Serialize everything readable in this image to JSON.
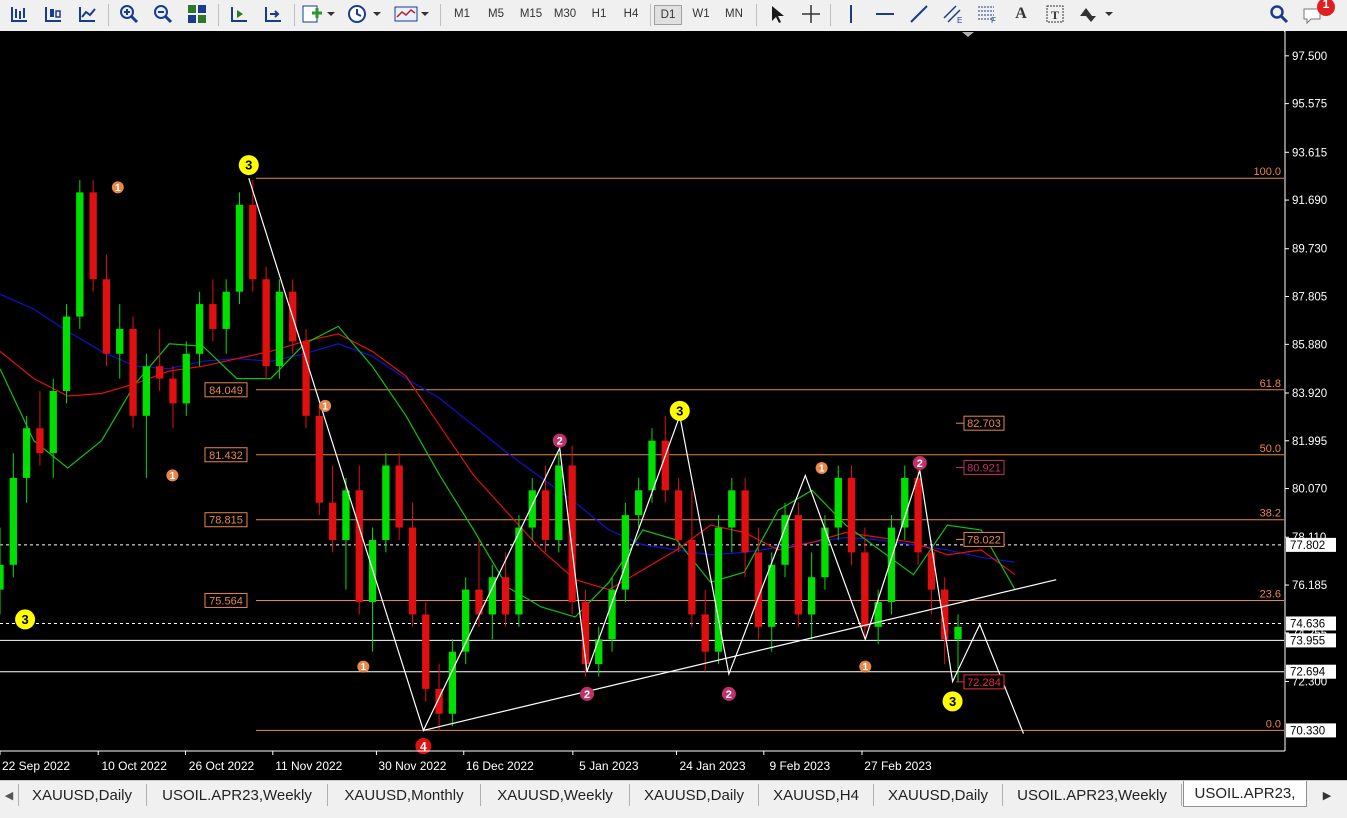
{
  "toolbar": {
    "timeframes": [
      "M1",
      "M5",
      "M15",
      "M30",
      "H1",
      "H4",
      "D1",
      "W1",
      "MN"
    ],
    "notification_count": "1",
    "icons": [
      "bar-chart-icon",
      "candlestick-icon",
      "line-chart-icon",
      "zoom-in-icon",
      "zoom-out-icon",
      "tile-windows-icon",
      "autoscroll-icon",
      "chart-shift-icon",
      "indicators-icon",
      "periods-clock-icon",
      "templates-icon",
      "cursor-icon",
      "crosshair-icon",
      "vertical-line-icon",
      "horizontal-line-icon",
      "trendline-icon",
      "equidistant-channel-icon",
      "fibonacci-icon",
      "text-icon",
      "text-label-icon",
      "shapes-icon",
      "search-icon",
      "notification-icon"
    ]
  },
  "chart_data": {
    "type": "candlestick",
    "symbol": "USOIL.APR23",
    "timeframe": "Daily",
    "ylim": [
      69.5,
      98.5
    ],
    "price_ticks": [
      "97.500",
      "95.575",
      "93.615",
      "91.690",
      "89.730",
      "87.805",
      "85.880",
      "83.920",
      "81.995",
      "80.070",
      "78.110",
      "76.185",
      "74.255",
      "72.300"
    ],
    "date_ticks": [
      "22 Sep 2022",
      "10 Oct 2022",
      "26 Oct 2022",
      "11 Nov 2022",
      "30 Nov 2022",
      "16 Dec 2022",
      "5 Jan 2023",
      "24 Jan 2023",
      "9 Feb 2023",
      "27 Feb 2023"
    ],
    "price_markers": [
      {
        "label": "77.802",
        "value": 77.802,
        "bg": "#ffffff",
        "fg": "#000000"
      },
      {
        "label": "74.636",
        "value": 74.636,
        "bg": "#ffffff",
        "fg": "#000000"
      },
      {
        "label": "73.955",
        "value": 73.955,
        "bg": "#ffffff",
        "fg": "#000000"
      },
      {
        "label": "72.694",
        "value": 72.694,
        "bg": "#ffffff",
        "fg": "#000000"
      },
      {
        "label": "70.330",
        "value": 70.33,
        "bg": "#ffffff",
        "fg": "#000000"
      }
    ],
    "fibonacci": {
      "color": "#e8874a",
      "levels": [
        {
          "ratio": "100.0",
          "price": 92.57
        },
        {
          "ratio": "61.8",
          "price": 84.049
        },
        {
          "ratio": "50.0",
          "price": 81.432
        },
        {
          "ratio": "38.2",
          "price": 78.815
        },
        {
          "ratio": "23.6",
          "price": 75.564
        },
        {
          "ratio": "0.0",
          "price": 70.33
        }
      ],
      "left_price_labels": [
        "84.049",
        "81.432",
        "78.815",
        "75.564"
      ]
    },
    "right_price_labels": [
      {
        "text": "82.703",
        "value": 82.703,
        "color": "#e8874a"
      },
      {
        "text": "80.921",
        "value": 80.921,
        "color": "#c0306a"
      },
      {
        "text": "78.022",
        "value": 78.022,
        "color": "#e8874a"
      },
      {
        "text": "72.284",
        "value": 72.284,
        "color": "#e83030"
      }
    ],
    "wave_labels": [
      {
        "text": "3",
        "value": 93.1,
        "x_ref": "2022-10-31",
        "style": "yellow"
      },
      {
        "text": "3",
        "value": 83.2,
        "x_ref": "2023-01-18",
        "style": "yellow"
      },
      {
        "text": "3",
        "value": 74.8,
        "x_ref": "2022-09-20",
        "style": "yellow"
      },
      {
        "text": "3",
        "value": 71.5,
        "x_ref": "2023-03-09",
        "style": "yellow"
      },
      {
        "text": "1",
        "value": 92.2,
        "x_ref": "2022-10-07",
        "style": "orange"
      },
      {
        "text": "1",
        "value": 80.6,
        "x_ref": "2022-10-17",
        "style": "orange"
      },
      {
        "text": "1",
        "value": 83.4,
        "x_ref": "2022-11-14",
        "style": "orange"
      },
      {
        "text": "1",
        "value": 72.9,
        "x_ref": "2022-11-21",
        "style": "orange"
      },
      {
        "text": "1",
        "value": 80.9,
        "x_ref": "2023-02-13",
        "style": "orange"
      },
      {
        "text": "1",
        "value": 72.9,
        "x_ref": "2023-02-21",
        "style": "orange"
      },
      {
        "text": "2",
        "value": 82.0,
        "x_ref": "2022-12-27",
        "style": "magenta"
      },
      {
        "text": "2",
        "value": 71.8,
        "x_ref": "2023-01-01",
        "style": "magenta"
      },
      {
        "text": "2",
        "value": 71.8,
        "x_ref": "2023-01-27",
        "style": "magenta"
      },
      {
        "text": "2",
        "value": 81.1,
        "x_ref": "2023-03-03",
        "style": "magenta"
      },
      {
        "text": "4",
        "value": 69.7,
        "x_ref": "2022-12-02",
        "style": "red"
      }
    ],
    "moving_averages": [
      {
        "color": "#1010d0",
        "values": [
          87.9,
          87.3,
          86.4,
          85.6,
          85.0,
          84.9,
          85.2,
          85.3,
          85.2,
          85.5,
          85.9,
          85.4,
          84.5,
          83.7,
          82.6,
          81.5,
          80.5,
          79.5,
          78.4,
          77.8,
          77.6,
          77.4,
          77.5,
          77.7,
          77.9,
          78.1,
          78.0,
          77.8,
          77.6,
          77.3,
          77.1
        ]
      },
      {
        "color": "#e01010",
        "values": [
          85.6,
          84.5,
          83.8,
          83.9,
          84.3,
          84.8,
          85.0,
          85.3,
          85.6,
          86.0,
          86.3,
          85.6,
          84.6,
          82.6,
          80.6,
          79.1,
          77.6,
          76.4,
          76.0,
          76.8,
          77.6,
          78.6,
          78.3,
          77.6,
          77.9,
          78.3,
          78.1,
          77.9,
          77.4,
          77.6,
          76.6
        ]
      },
      {
        "color": "#10c010",
        "values": [
          84.9,
          82.0,
          80.9,
          82.0,
          84.3,
          85.9,
          85.8,
          84.5,
          84.5,
          85.9,
          86.6,
          85.0,
          83.0,
          80.6,
          78.4,
          76.1,
          75.3,
          74.9,
          76.3,
          78.4,
          78.0,
          76.3,
          76.7,
          79.2,
          80.0,
          78.6,
          77.6,
          76.6,
          78.6,
          78.4,
          76.0
        ]
      }
    ],
    "candles_ohlc": [
      [
        76.0,
        78.5,
        75.0,
        77.0
      ],
      [
        77.0,
        81.5,
        76.5,
        80.5
      ],
      [
        80.5,
        83.0,
        79.5,
        82.5
      ],
      [
        82.5,
        84.0,
        81.0,
        81.5
      ],
      [
        81.5,
        84.5,
        80.5,
        84.0
      ],
      [
        84.0,
        87.5,
        83.5,
        87.0
      ],
      [
        87.0,
        92.5,
        86.5,
        92.0
      ],
      [
        92.0,
        92.5,
        88.0,
        88.5
      ],
      [
        88.5,
        89.5,
        85.0,
        85.5
      ],
      [
        85.5,
        87.5,
        84.5,
        86.5
      ],
      [
        86.5,
        87.0,
        82.5,
        83.0
      ],
      [
        83.0,
        85.5,
        80.5,
        85.0
      ],
      [
        85.0,
        86.5,
        84.0,
        84.5
      ],
      [
        84.5,
        85.0,
        82.5,
        83.5
      ],
      [
        83.5,
        86.0,
        83.0,
        85.5
      ],
      [
        85.5,
        88.0,
        85.0,
        87.5
      ],
      [
        87.5,
        88.5,
        86.0,
        86.5
      ],
      [
        86.5,
        88.5,
        85.5,
        88.0
      ],
      [
        88.0,
        92.0,
        87.5,
        91.5
      ],
      [
        91.5,
        92.5,
        88.0,
        88.5
      ],
      [
        88.5,
        89.0,
        84.5,
        85.0
      ],
      [
        85.0,
        88.5,
        84.5,
        88.0
      ],
      [
        88.0,
        88.5,
        85.5,
        86.0
      ],
      [
        86.0,
        86.5,
        82.5,
        83.0
      ],
      [
        83.0,
        83.5,
        79.0,
        79.5
      ],
      [
        79.5,
        81.0,
        77.5,
        78.0
      ],
      [
        78.0,
        80.5,
        76.0,
        80.0
      ],
      [
        80.0,
        81.0,
        75.0,
        75.5
      ],
      [
        75.5,
        78.5,
        73.5,
        78.0
      ],
      [
        78.0,
        81.5,
        77.5,
        81.0
      ],
      [
        81.0,
        81.5,
        78.0,
        78.5
      ],
      [
        78.5,
        79.5,
        74.5,
        75.0
      ],
      [
        75.0,
        75.5,
        71.5,
        72.0
      ],
      [
        72.0,
        73.0,
        70.3,
        71.0
      ],
      [
        71.0,
        74.0,
        70.5,
        73.5
      ],
      [
        73.5,
        76.5,
        73.0,
        76.0
      ],
      [
        76.0,
        78.0,
        74.5,
        75.0
      ],
      [
        75.0,
        77.0,
        74.0,
        76.5
      ],
      [
        76.5,
        77.5,
        74.5,
        75.0
      ],
      [
        75.0,
        79.0,
        74.5,
        78.5
      ],
      [
        78.5,
        80.5,
        78.0,
        80.0
      ],
      [
        80.0,
        81.0,
        77.5,
        78.0
      ],
      [
        78.0,
        81.5,
        77.5,
        81.0
      ],
      [
        81.0,
        81.8,
        75.0,
        75.5
      ],
      [
        75.5,
        76.0,
        72.5,
        73.0
      ],
      [
        73.0,
        74.5,
        72.5,
        74.0
      ],
      [
        74.0,
        76.5,
        73.5,
        76.0
      ],
      [
        76.0,
        79.5,
        75.5,
        79.0
      ],
      [
        79.0,
        80.5,
        78.5,
        80.0
      ],
      [
        80.0,
        82.5,
        79.5,
        82.0
      ],
      [
        82.0,
        83.0,
        79.5,
        80.0
      ],
      [
        80.0,
        80.5,
        77.5,
        78.0
      ],
      [
        78.0,
        80.0,
        74.5,
        75.0
      ],
      [
        75.0,
        76.0,
        72.7,
        73.5
      ],
      [
        73.5,
        79.0,
        73.0,
        78.5
      ],
      [
        78.5,
        80.5,
        77.5,
        80.0
      ],
      [
        80.0,
        80.5,
        76.5,
        77.5
      ],
      [
        77.5,
        78.5,
        74.0,
        74.5
      ],
      [
        74.5,
        77.5,
        73.5,
        77.0
      ],
      [
        77.0,
        79.5,
        76.5,
        79.0
      ],
      [
        79.0,
        79.5,
        74.5,
        75.0
      ],
      [
        75.0,
        77.5,
        74.0,
        76.5
      ],
      [
        76.5,
        79.0,
        76.0,
        78.5
      ],
      [
        78.5,
        81.0,
        78.0,
        80.5
      ],
      [
        80.5,
        81.0,
        77.0,
        77.5
      ],
      [
        77.5,
        78.5,
        74.0,
        74.5
      ],
      [
        74.5,
        76.0,
        73.8,
        75.5
      ],
      [
        75.5,
        79.0,
        75.0,
        78.5
      ],
      [
        78.5,
        81.0,
        78.0,
        80.5
      ],
      [
        80.5,
        81.0,
        77.0,
        77.5
      ],
      [
        77.5,
        78.0,
        75.0,
        76.0
      ],
      [
        76.0,
        76.5,
        73.0,
        74.0
      ],
      [
        74.0,
        75.0,
        72.3,
        74.5
      ]
    ],
    "trendlines": [
      {
        "color": "#ffffff",
        "points": [
          [
            "2022-10-31",
            92.57
          ],
          [
            "2022-12-02",
            70.33
          ],
          [
            "2022-12-27",
            81.7
          ],
          [
            "2023-01-01",
            72.7
          ],
          [
            "2023-01-18",
            83.0
          ],
          [
            "2023-01-27",
            72.6
          ],
          [
            "2023-02-10",
            80.6
          ],
          [
            "2023-02-21",
            74.0
          ],
          [
            "2023-03-03",
            80.8
          ],
          [
            "2023-03-09",
            72.3
          ],
          [
            "2023-03-14",
            74.6
          ],
          [
            "2023-03-22",
            70.2
          ]
        ]
      },
      {
        "color": "#ffffff",
        "points": [
          [
            "2022-12-02",
            70.33
          ],
          [
            "2023-03-28",
            76.4
          ]
        ]
      }
    ],
    "horizontal_lines": [
      {
        "value": 77.802,
        "style": "dashed",
        "color": "#ffffff"
      },
      {
        "value": 74.636,
        "style": "dashed",
        "color": "#ffffff"
      },
      {
        "value": 73.955,
        "style": "solid",
        "color": "#ffffff"
      },
      {
        "value": 72.694,
        "style": "solid",
        "color": "#ffffff"
      }
    ],
    "bull_color": "#00e000",
    "bear_color": "#e01010",
    "grid": false
  },
  "tabs": [
    {
      "label": "XAUUSD,Daily",
      "active": false
    },
    {
      "label": "USOIL.APR23,Weekly",
      "active": false
    },
    {
      "label": "XAUUSD,Monthly",
      "active": false
    },
    {
      "label": "XAUUSD,Weekly",
      "active": false
    },
    {
      "label": "XAUUSD,Daily",
      "active": false
    },
    {
      "label": "XAUUSD,H4",
      "active": false
    },
    {
      "label": "XAUUSD,Daily",
      "active": false
    },
    {
      "label": "USOIL.APR23,Weekly",
      "active": false
    },
    {
      "label": "USOIL.APR23,",
      "active": true
    }
  ]
}
